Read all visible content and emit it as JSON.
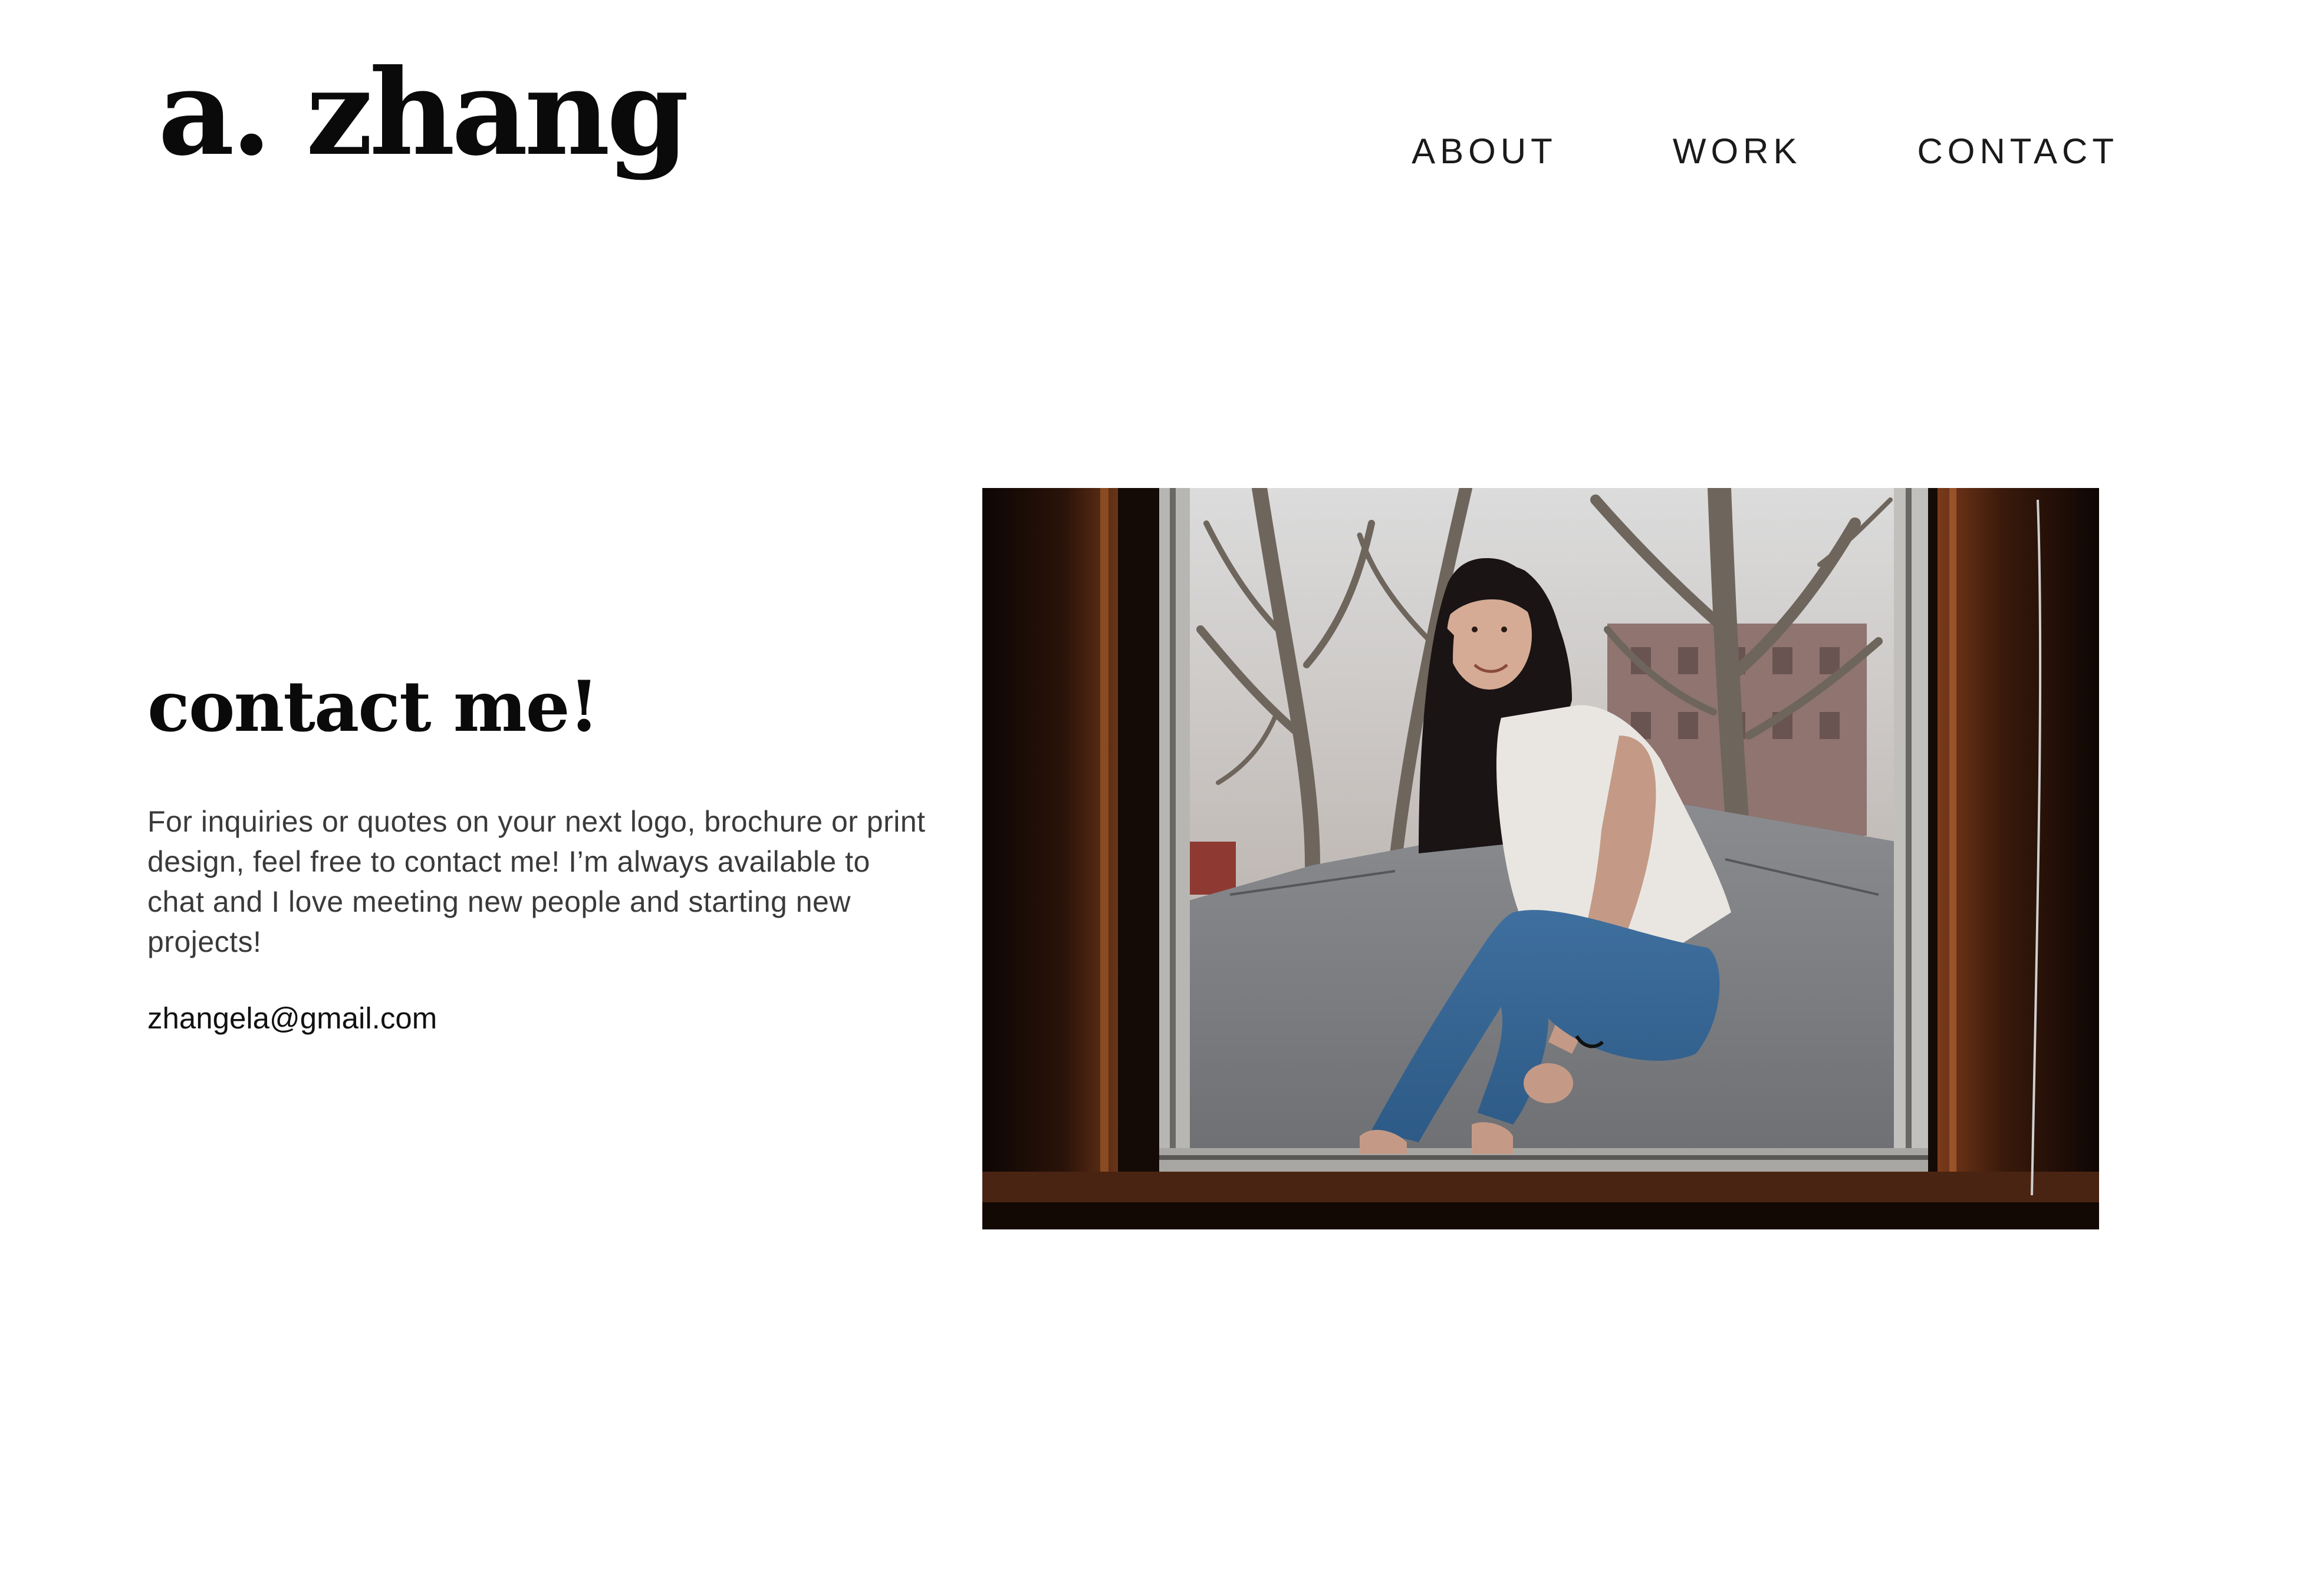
{
  "header": {
    "logo": "a. zhang",
    "nav": {
      "about": "ABOUT",
      "work": "WORK",
      "contact": "CONTACT"
    }
  },
  "contact": {
    "title": "contact me!",
    "body": "For inquiries or quotes on your next logo, brochure or print design, feel free to contact me! I’m always available to chat and I love meeting new people and starting new projects!",
    "email": "zhangela@gmail.com"
  },
  "photo": {
    "description_icon": "portrait-photo"
  },
  "colors": {
    "text_dark": "#0a0a0a",
    "body_text": "#3a3a3a",
    "background": "#ffffff"
  }
}
